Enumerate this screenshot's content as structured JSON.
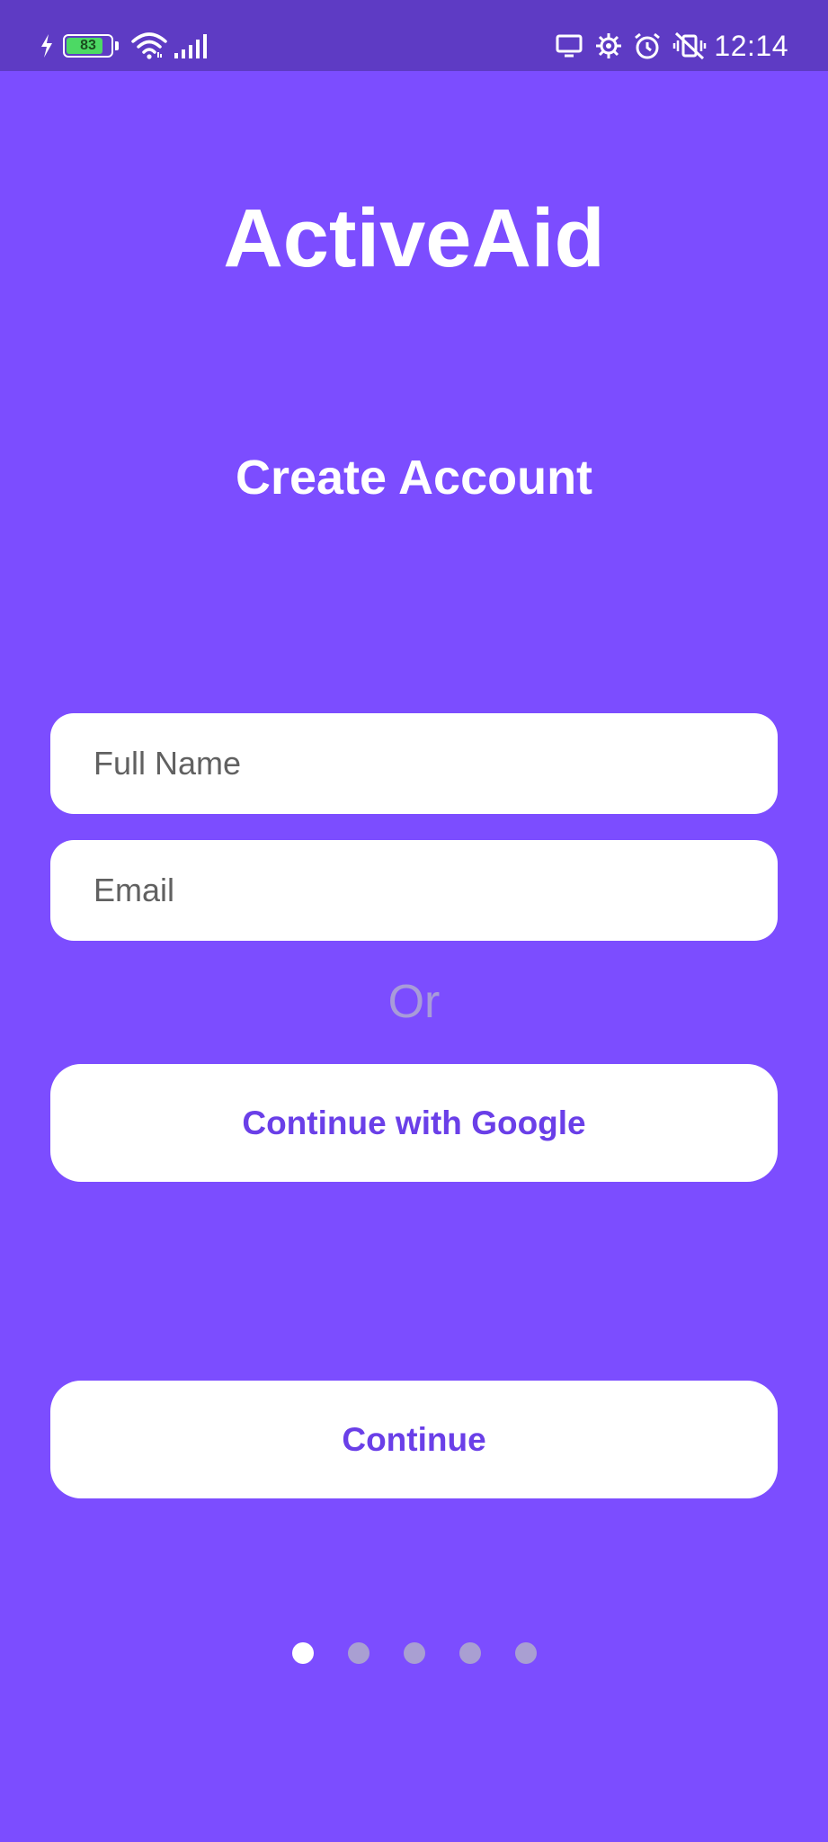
{
  "status_bar": {
    "battery_level": "83",
    "time": "12:14",
    "left_icons": [
      "charging-bolt-icon",
      "battery-icon",
      "wifi-icon",
      "signal-bars-icon"
    ],
    "right_icons": [
      "screen-cast-icon",
      "settings-gear-icon",
      "alarm-clock-icon",
      "vibrate-off-icon"
    ]
  },
  "app": {
    "title": "ActiveAid"
  },
  "screen": {
    "title": "Create Account"
  },
  "form": {
    "full_name": {
      "placeholder": "Full Name",
      "value": ""
    },
    "email": {
      "placeholder": "Email",
      "value": ""
    }
  },
  "divider_text": "Or",
  "buttons": {
    "google_label": "Continue with Google",
    "continue_label": "Continue"
  },
  "pagination": {
    "total": 5,
    "current": 1
  },
  "colors": {
    "background": "#7c4dff",
    "status_bar": "#5e3bc4",
    "button_text": "#6a3fe8",
    "dot_inactive": "#a99fd2",
    "dot_active": "#ffffff"
  }
}
